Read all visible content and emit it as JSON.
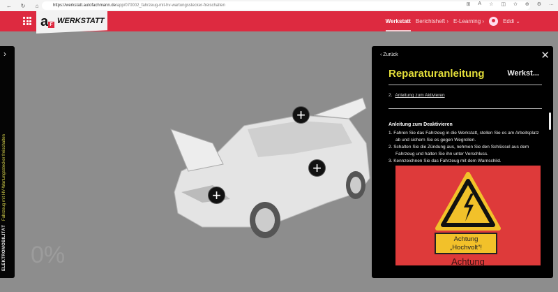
{
  "browser": {
    "url_host": "https://werkstatt.autofachmann.de",
    "url_path": "/app/070002_fahrzeug-mit-hv-wartungsstecker-freischalten",
    "back": "←",
    "reload": "↻",
    "home": "⌂",
    "icons": [
      "⊞",
      "A",
      "☆",
      "◫",
      "✩",
      "⊕",
      "⚙",
      "…"
    ]
  },
  "header": {
    "logo_letter": "a",
    "logo_sub": "F",
    "logo_text": "WERKSTATT",
    "nav": [
      {
        "label": "Werkstatt"
      },
      {
        "label": "Berichtsheft ›"
      },
      {
        "label": "E-Learning ›"
      }
    ],
    "user": "Eddi ⌄"
  },
  "sidebar": {
    "category": "ELEKTROMOBILITÄT",
    "title": "Fahrzeug mit HV-Wartungsstecker freischalten",
    "progress": "0%"
  },
  "panel": {
    "back": "Zurück",
    "title": "Reparaturanleitung",
    "short_title": "Werkst...",
    "link_num": "2.",
    "link": "Anleitung zum Aktivieren",
    "section": "Anleitung zum Deaktivieren",
    "steps": [
      "1. Fahren Sie das Fahrzeug in die Werkstatt, stellen Sie es am Arbeitsplatz ab und sichern Sie es gegen Wegrollen.",
      "2. Schalten Sie die Zündung aus, nehmen Sie den Schlüssel aus dem Fahrzeug und halten Sie ihn unter Verschluss.",
      "3. Kennzeichnen Sie das Fahrzeug mit dem Warnschild."
    ],
    "sign_line1": "Achtung",
    "sign_line2": "„Hochvolt“!",
    "sign_below": "Achtung"
  },
  "hotspot": "+"
}
